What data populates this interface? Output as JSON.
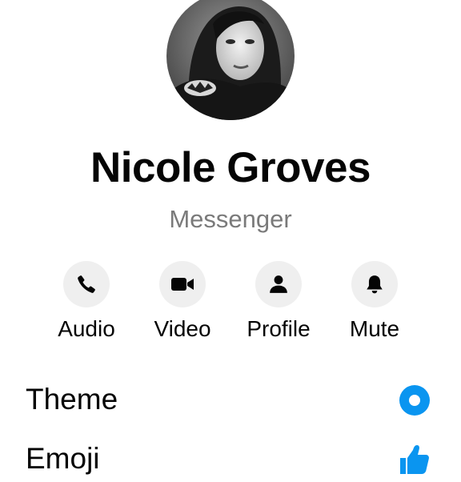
{
  "profile": {
    "name": "Nicole Groves",
    "source": "Messenger",
    "avatar_icon": "profile-photo"
  },
  "actions": [
    {
      "label": "Audio",
      "icon": "phone-icon"
    },
    {
      "label": "Video",
      "icon": "video-camera-icon"
    },
    {
      "label": "Profile",
      "icon": "person-icon"
    },
    {
      "label": "Mute",
      "icon": "bell-icon"
    }
  ],
  "settings": [
    {
      "label": "Theme",
      "icon": "theme-circle-icon"
    },
    {
      "label": "Emoji",
      "icon": "thumbs-up-icon"
    }
  ],
  "colors": {
    "accent": "#0a95f0",
    "icon_bg": "#efefef",
    "subtitle": "#7a7a7a"
  }
}
